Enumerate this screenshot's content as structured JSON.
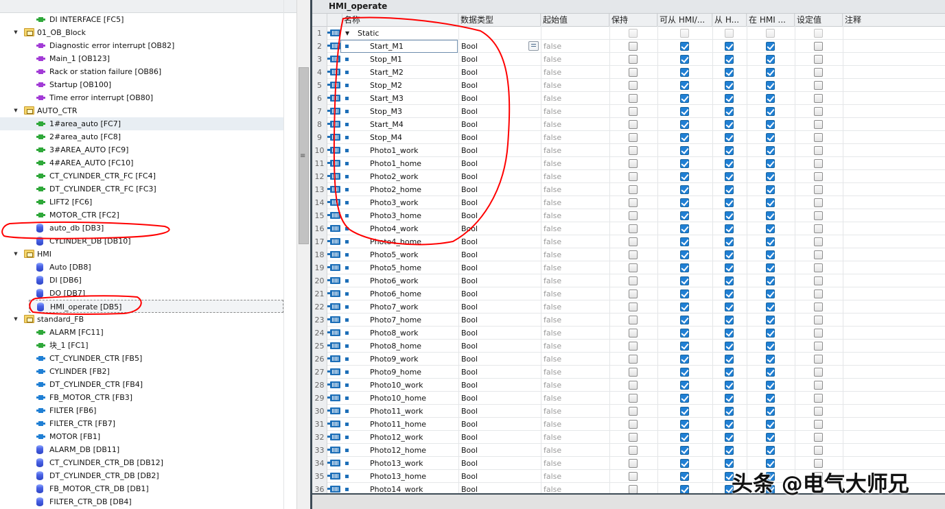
{
  "tree": {
    "items": [
      {
        "label": "DI INTERFACE [FC5]",
        "kind": "fc",
        "level": 2
      },
      {
        "label": "01_OB_Block",
        "kind": "folder",
        "level": 1,
        "expanded": true
      },
      {
        "label": "Diagnostic error interrupt [OB82]",
        "kind": "ob",
        "level": 2
      },
      {
        "label": "Main_1 [OB123]",
        "kind": "ob",
        "level": 2
      },
      {
        "label": "Rack or station failure [OB86]",
        "kind": "ob",
        "level": 2
      },
      {
        "label": "Startup [OB100]",
        "kind": "ob",
        "level": 2
      },
      {
        "label": "Time error interrupt [OB80]",
        "kind": "ob",
        "level": 2
      },
      {
        "label": "AUTO_CTR",
        "kind": "folder",
        "level": 1,
        "expanded": true
      },
      {
        "label": "1#area_auto [FC7]",
        "kind": "fc",
        "level": 2,
        "highlight": true
      },
      {
        "label": "2#area_auto [FC8]",
        "kind": "fc",
        "level": 2
      },
      {
        "label": "3#AREA_AUTO [FC9]",
        "kind": "fc",
        "level": 2
      },
      {
        "label": "4#AREA_AUTO [FC10]",
        "kind": "fc",
        "level": 2
      },
      {
        "label": "CT_CYLINDER_CTR_FC [FC4]",
        "kind": "fc",
        "level": 2
      },
      {
        "label": "DT_CYLINDER_CTR_FC [FC3]",
        "kind": "fc",
        "level": 2
      },
      {
        "label": "LIFT2 [FC6]",
        "kind": "fc",
        "level": 2
      },
      {
        "label": "MOTOR_CTR [FC2]",
        "kind": "fc",
        "level": 2
      },
      {
        "label": "auto_db [DB3]",
        "kind": "db",
        "level": 2
      },
      {
        "label": "CYLINDER_DB [DB10]",
        "kind": "db",
        "level": 2
      },
      {
        "label": "HMI",
        "kind": "folder",
        "level": 1,
        "expanded": true
      },
      {
        "label": "Auto [DB8]",
        "kind": "db",
        "level": 2
      },
      {
        "label": "DI [DB6]",
        "kind": "db",
        "level": 2
      },
      {
        "label": "DO [DB7]",
        "kind": "db",
        "level": 2
      },
      {
        "label": "HMI_operate [DB5]",
        "kind": "db",
        "level": 2,
        "selected": true
      },
      {
        "label": "standard_FB",
        "kind": "folder",
        "level": 1,
        "expanded": true
      },
      {
        "label": "ALARM [FC11]",
        "kind": "fc",
        "level": 2
      },
      {
        "label": "块_1 [FC1]",
        "kind": "fc",
        "level": 2
      },
      {
        "label": "CT_CYLINDER_CTR [FB5]",
        "kind": "fb",
        "level": 2
      },
      {
        "label": "CYLINDER [FB2]",
        "kind": "fb",
        "level": 2
      },
      {
        "label": "DT_CYLINDER_CTR [FB4]",
        "kind": "fb",
        "level": 2
      },
      {
        "label": "FB_MOTOR_CTR [FB3]",
        "kind": "fb",
        "level": 2
      },
      {
        "label": "FILTER [FB6]",
        "kind": "fb",
        "level": 2
      },
      {
        "label": "FILTER_CTR [FB7]",
        "kind": "fb",
        "level": 2
      },
      {
        "label": "MOTOR [FB1]",
        "kind": "fb",
        "level": 2
      },
      {
        "label": "ALARM_DB [DB11]",
        "kind": "db",
        "level": 2
      },
      {
        "label": "CT_CYLINDER_CTR_DB [DB12]",
        "kind": "db",
        "level": 2
      },
      {
        "label": "DT_CYLINDER_CTR_DB [DB2]",
        "kind": "db",
        "level": 2
      },
      {
        "label": "FB_MOTOR_CTR_DB [DB1]",
        "kind": "db",
        "level": 2
      },
      {
        "label": "FILTER_CTR_DB [DB4]",
        "kind": "db",
        "level": 2
      }
    ]
  },
  "editor": {
    "title": "HMI_operate",
    "columns": [
      "名称",
      "数据类型",
      "起始值",
      "保持",
      "可从 HMI/...",
      "从 H...",
      "在 HMI ...",
      "设定值",
      "注释"
    ],
    "static_row": {
      "num": "1",
      "name": "Static"
    },
    "rows": [
      {
        "num": "2",
        "name": "Start_M1",
        "type": "Bool",
        "start": "false"
      },
      {
        "num": "3",
        "name": "Stop_M1",
        "type": "Bool",
        "start": "false"
      },
      {
        "num": "4",
        "name": "Start_M2",
        "type": "Bool",
        "start": "false"
      },
      {
        "num": "5",
        "name": "Stop_M2",
        "type": "Bool",
        "start": "false"
      },
      {
        "num": "6",
        "name": "Start_M3",
        "type": "Bool",
        "start": "false"
      },
      {
        "num": "7",
        "name": "Stop_M3",
        "type": "Bool",
        "start": "false"
      },
      {
        "num": "8",
        "name": "Start_M4",
        "type": "Bool",
        "start": "false"
      },
      {
        "num": "9",
        "name": "Stop_M4",
        "type": "Bool",
        "start": "false"
      },
      {
        "num": "10",
        "name": "Photo1_work",
        "type": "Bool",
        "start": "false"
      },
      {
        "num": "11",
        "name": "Photo1_home",
        "type": "Bool",
        "start": "false"
      },
      {
        "num": "12",
        "name": "Photo2_work",
        "type": "Bool",
        "start": "false"
      },
      {
        "num": "13",
        "name": "Photo2_home",
        "type": "Bool",
        "start": "false"
      },
      {
        "num": "14",
        "name": "Photo3_work",
        "type": "Bool",
        "start": "false"
      },
      {
        "num": "15",
        "name": "Photo3_home",
        "type": "Bool",
        "start": "false"
      },
      {
        "num": "16",
        "name": "Photo4_work",
        "type": "Bool",
        "start": "false"
      },
      {
        "num": "17",
        "name": "Photo4_home",
        "type": "Bool",
        "start": "false"
      },
      {
        "num": "18",
        "name": "Photo5_work",
        "type": "Bool",
        "start": "false"
      },
      {
        "num": "19",
        "name": "Photo5_home",
        "type": "Bool",
        "start": "false"
      },
      {
        "num": "20",
        "name": "Photo6_work",
        "type": "Bool",
        "start": "false"
      },
      {
        "num": "21",
        "name": "Photo6_home",
        "type": "Bool",
        "start": "false"
      },
      {
        "num": "22",
        "name": "Photo7_work",
        "type": "Bool",
        "start": "false"
      },
      {
        "num": "23",
        "name": "Photo7_home",
        "type": "Bool",
        "start": "false"
      },
      {
        "num": "24",
        "name": "Photo8_work",
        "type": "Bool",
        "start": "false"
      },
      {
        "num": "25",
        "name": "Photo8_home",
        "type": "Bool",
        "start": "false"
      },
      {
        "num": "26",
        "name": "Photo9_work",
        "type": "Bool",
        "start": "false"
      },
      {
        "num": "27",
        "name": "Photo9_home",
        "type": "Bool",
        "start": "false"
      },
      {
        "num": "28",
        "name": "Photo10_work",
        "type": "Bool",
        "start": "false"
      },
      {
        "num": "29",
        "name": "Photo10_home",
        "type": "Bool",
        "start": "false"
      },
      {
        "num": "30",
        "name": "Photo11_work",
        "type": "Bool",
        "start": "false"
      },
      {
        "num": "31",
        "name": "Photo11_home",
        "type": "Bool",
        "start": "false"
      },
      {
        "num": "32",
        "name": "Photo12_work",
        "type": "Bool",
        "start": "false"
      },
      {
        "num": "33",
        "name": "Photo12_home",
        "type": "Bool",
        "start": "false"
      },
      {
        "num": "34",
        "name": "Photo13_work",
        "type": "Bool",
        "start": "false"
      },
      {
        "num": "35",
        "name": "Photo13_home",
        "type": "Bool",
        "start": "false"
      },
      {
        "num": "36",
        "name": "Photo14_work",
        "type": "Bool",
        "start": "false"
      }
    ],
    "row_flags": {
      "retain": false,
      "accessible_from_hmi": true,
      "writable_from_hmi": true,
      "visible_in_hmi": true,
      "setpoint": false
    }
  },
  "watermark": "头条 @电气大师兄",
  "annotation_color": "#ff0000"
}
